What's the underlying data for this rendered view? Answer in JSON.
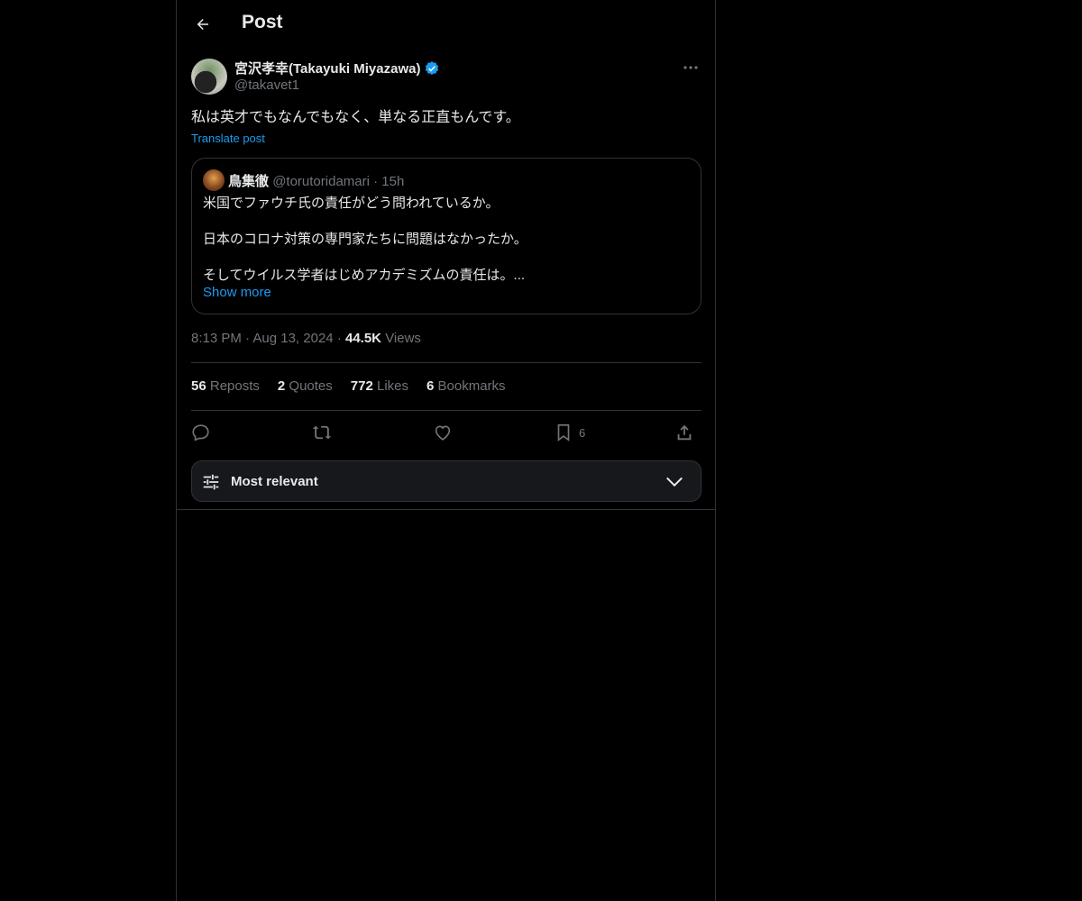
{
  "header": {
    "title": "Post"
  },
  "author": {
    "name": "宮沢孝幸(Takayuki Miyazawa)",
    "handle": "@takavet1"
  },
  "post": {
    "text": "私は英才でもなんでもなく、単なる正直もんです。",
    "translate_label": "Translate post"
  },
  "quote": {
    "name": "鳥集徹",
    "handle": "@torutoridamari",
    "dot": "·",
    "time": "15h",
    "lines": [
      "米国でファウチ氏の責任がどう問われているか。",
      "日本のコロナ対策の専門家たちに問題はなかったか。",
      "そしてウイルス学者はじめアカデミズムの責任は。..."
    ],
    "show_more": "Show more"
  },
  "meta": {
    "time": "8:13 PM",
    "dot1": "·",
    "date": "Aug 13, 2024",
    "dot2": "·",
    "views_count": "44.5K",
    "views_label": "Views"
  },
  "stats": {
    "reposts_count": "56",
    "reposts_label": "Reposts",
    "quotes_count": "2",
    "quotes_label": "Quotes",
    "likes_count": "772",
    "likes_label": "Likes",
    "bookmarks_count": "6",
    "bookmarks_label": "Bookmarks"
  },
  "actions": {
    "bookmark_count": "6"
  },
  "sort": {
    "label": "Most relevant"
  },
  "colors": {
    "accent": "#1d9bf0",
    "text": "#e7e9ea",
    "muted": "#71767b",
    "border": "#2f3336"
  },
  "icons": [
    "back-arrow-icon",
    "verified-badge-icon",
    "more-icon",
    "reply-icon",
    "repost-icon",
    "like-icon",
    "bookmark-icon",
    "share-icon",
    "sort-sliders-icon",
    "chevron-down-icon"
  ]
}
